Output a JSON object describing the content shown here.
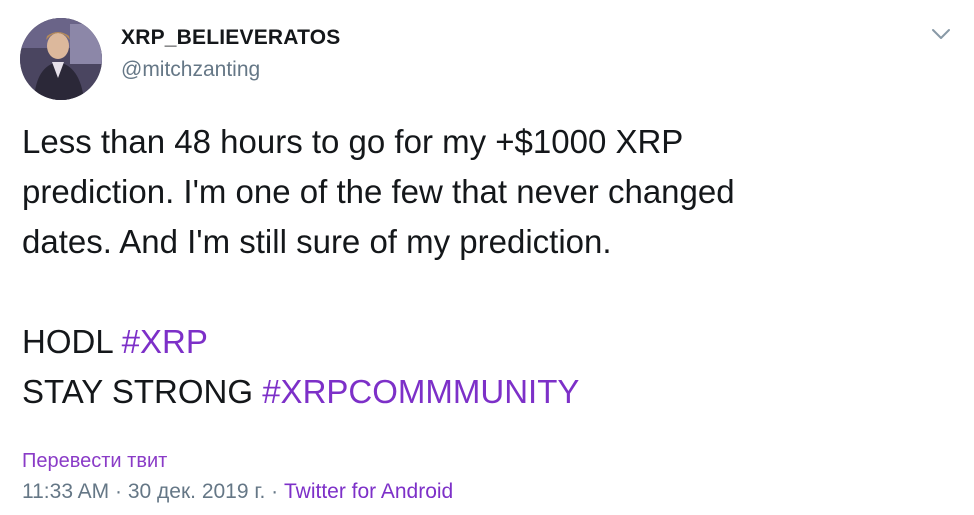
{
  "tweet": {
    "author": {
      "display_name": "XRP_BELIEVERATOS",
      "handle": "@mitchzanting"
    },
    "text": {
      "line1": "Less than 48 hours to go for my +$1000 XRP",
      "line2": "prediction. I'm one of the few that never changed",
      "line3": "dates. And I'm still sure of my prediction.",
      "line5_prefix": "HODL ",
      "line5_hashtag": "#XRP",
      "line6_prefix": "STAY STRONG ",
      "line6_hashtag": "#XRPCOMMMUNITY"
    },
    "translate_link": "Перевести твит",
    "time": "11:33 AM",
    "separator": " · ",
    "date": "30 дек. 2019 г.",
    "source": "Twitter for Android",
    "icons": {
      "menu": "chevron-down-icon",
      "avatar": "profile-photo"
    },
    "colors": {
      "hashtag": "#7d30c8",
      "muted": "#657786",
      "text": "#14171a"
    }
  }
}
